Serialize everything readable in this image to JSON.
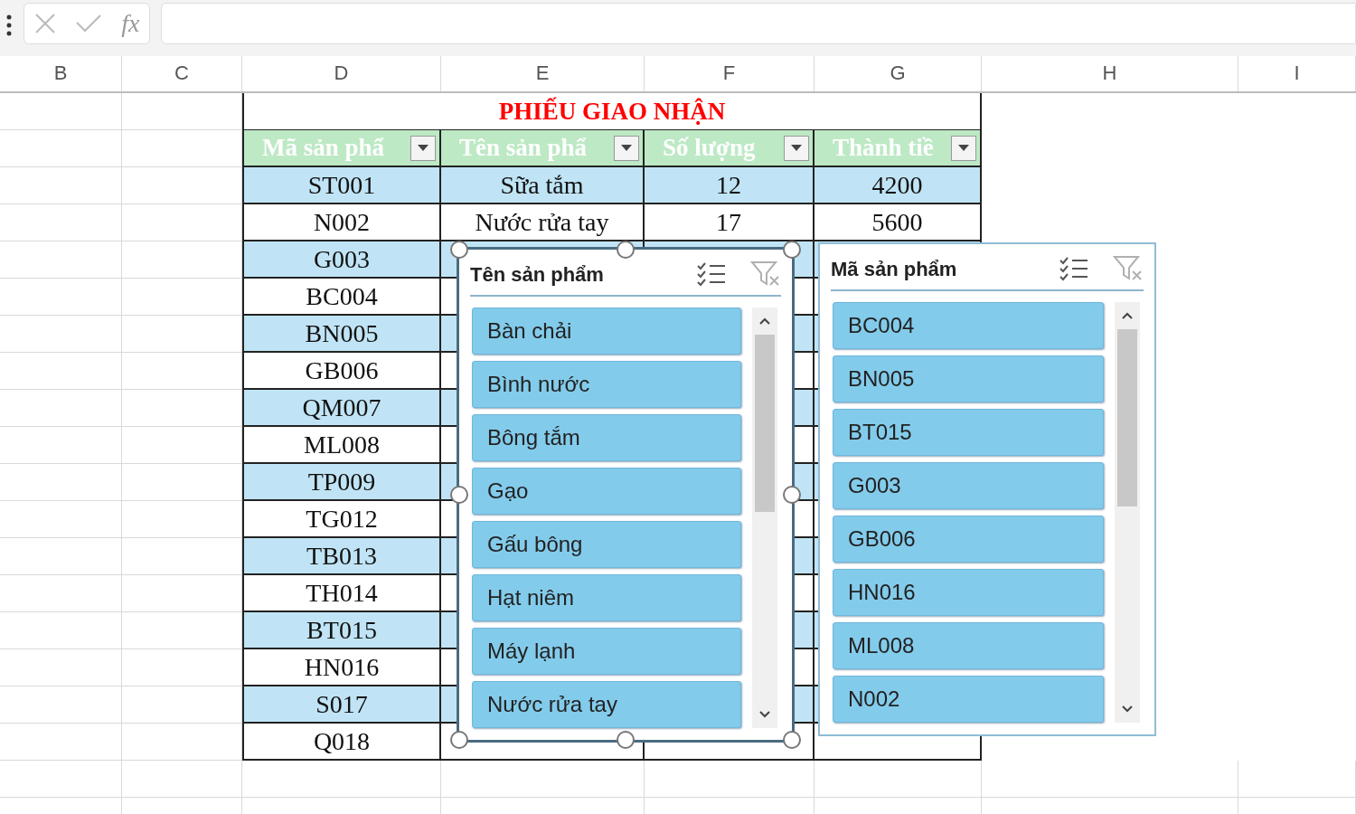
{
  "formula_bar": {
    "function_label": "fx"
  },
  "columns": [
    "B",
    "C",
    "D",
    "E",
    "F",
    "G",
    "H",
    "I"
  ],
  "table": {
    "title": "PHIẾU GIAO NHẬN",
    "headers": [
      "Mã sản phẩ",
      "Tên sản phẩ",
      "Số lượng",
      "Thành tiề"
    ],
    "rows": [
      {
        "cells": [
          "ST001",
          "Sữa tắm",
          "12",
          "4200"
        ]
      },
      {
        "cells": [
          "N002",
          "Nước rửa tay",
          "17",
          "5600"
        ]
      },
      {
        "cells": [
          "G003"
        ]
      },
      {
        "cells": [
          "BC004"
        ]
      },
      {
        "cells": [
          "BN005"
        ]
      },
      {
        "cells": [
          "GB006"
        ]
      },
      {
        "cells": [
          "QM007"
        ]
      },
      {
        "cells": [
          "ML008"
        ]
      },
      {
        "cells": [
          "TP009"
        ]
      },
      {
        "cells": [
          "TG012"
        ]
      },
      {
        "cells": [
          "TB013"
        ]
      },
      {
        "cells": [
          "TH014"
        ]
      },
      {
        "cells": [
          "BT015"
        ]
      },
      {
        "cells": [
          "HN016"
        ]
      },
      {
        "cells": [
          "S017"
        ]
      },
      {
        "cells": [
          "Q018"
        ]
      }
    ]
  },
  "slicers": [
    {
      "title": "Tên sản phẩm",
      "selected": true,
      "items": [
        {
          "label": "Bàn chải",
          "selected": true
        },
        {
          "label": "Bình nước",
          "selected": true
        },
        {
          "label": "Bông tắm",
          "selected": true
        },
        {
          "label": "Gạo",
          "selected": true
        },
        {
          "label": "Gấu bông",
          "selected": true
        },
        {
          "label": "Hạt niêm",
          "selected": true
        },
        {
          "label": "Máy lạnh",
          "selected": true
        },
        {
          "label": "Nước rửa tay",
          "selected": true
        }
      ]
    },
    {
      "title": "Mã sản phẩm",
      "selected": false,
      "items": [
        {
          "label": "BC004",
          "selected": true
        },
        {
          "label": "BN005",
          "selected": true
        },
        {
          "label": "BT015",
          "selected": true
        },
        {
          "label": "G003",
          "selected": true
        },
        {
          "label": "GB006",
          "selected": true
        },
        {
          "label": "HN016",
          "selected": true
        },
        {
          "label": "ML008",
          "selected": true
        },
        {
          "label": "N002",
          "selected": true
        }
      ]
    }
  ]
}
